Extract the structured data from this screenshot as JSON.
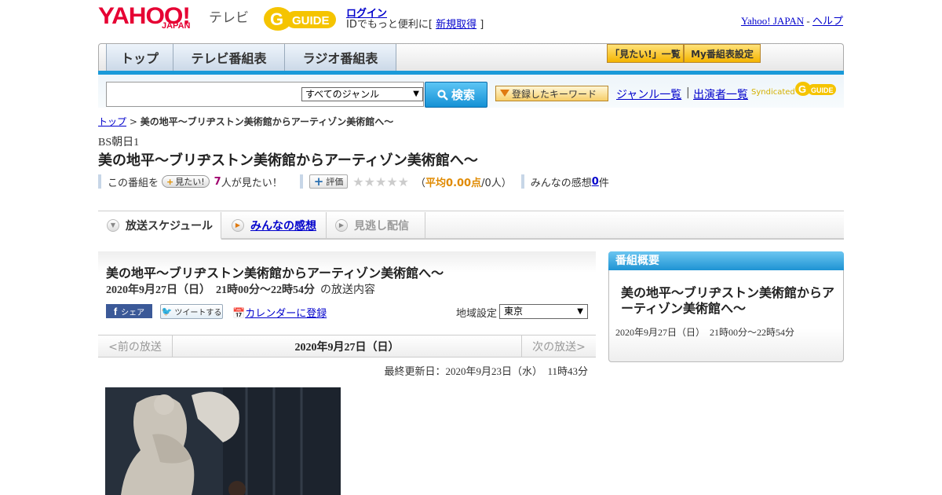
{
  "header": {
    "logo_yahoo": "YAHOO!",
    "logo_japan": "JAPAN",
    "logo_tv": "テレビ",
    "gguide_logo": "GUIDE",
    "login": "ログイン",
    "login_note_prefix": "IDでもっと便利に[",
    "signup": "新規取得",
    "login_note_suffix": "]",
    "yahoo_japan_link": "Yahoo! JAPAN",
    "sep": " - ",
    "help_link": "ヘルプ"
  },
  "nav": {
    "tabs": [
      "トップ",
      "テレビ番組表",
      "ラジオ番組表"
    ],
    "want_list": "「見たい!」一覧",
    "my_schedule": "My番組表設定"
  },
  "search": {
    "genre": "すべてのジャンル",
    "button": "検索",
    "keywords": "登録したキーワード",
    "genre_list": "ジャンル一覧",
    "sep": "|",
    "cast_list": "出演者一覧",
    "syndicated": "Syndicated"
  },
  "breadcrumb": {
    "home": "トップ",
    "sep": " > ",
    "current": "美の地平～ブリヂストン美術館からアーティゾン美術館へ～"
  },
  "program": {
    "station": "BS朝日1",
    "title": "美の地平～ブリヂストン美術館からアーティゾン美術館へ～",
    "want_prefix": "この番組を",
    "want_button": "見たい!",
    "want_count": "7",
    "want_suffix": "人が見たい！",
    "rate_button": "評価",
    "stars": "★★★★★",
    "rating_prefix": "（",
    "rating_value": "平均0.00点",
    "rating_suffix": "/0人）",
    "comments_prefix": "みんなの感想 ",
    "comments_count": "0",
    "comments_suffix": "件"
  },
  "tabs": {
    "schedule": "放送スケジュール",
    "comments": "みんなの感想",
    "catchup": "見逃し配信"
  },
  "broadcast": {
    "title": "美の地平～ブリヂストン美術館からアーティゾン美術館へ～",
    "datetime": "2020年9月27日（日）　21時00分～22時54分",
    "datetime_suffix": "の放送内容",
    "fb_share": "シェア",
    "tweet": "ツイートする",
    "calendar": "カレンダーに登録",
    "region_label": "地域設定",
    "region": "東京",
    "prev": "<前の放送",
    "current_date": "2020年9月27日（日）",
    "next": "次の放送>",
    "updated": "最終更新日：2020年9月23日（水）　11時43分"
  },
  "sidebar": {
    "heading": "番組概要",
    "title": "美の地平～ブリヂストン美術館からアーティゾン美術館へ～",
    "datetime": "2020年9月27日（日）　21時00分～22時54分"
  },
  "colors": {
    "accent_blue": "#1a9ad9",
    "yahoo_red": "#e60033",
    "gguide_yellow": "#f5c400"
  }
}
